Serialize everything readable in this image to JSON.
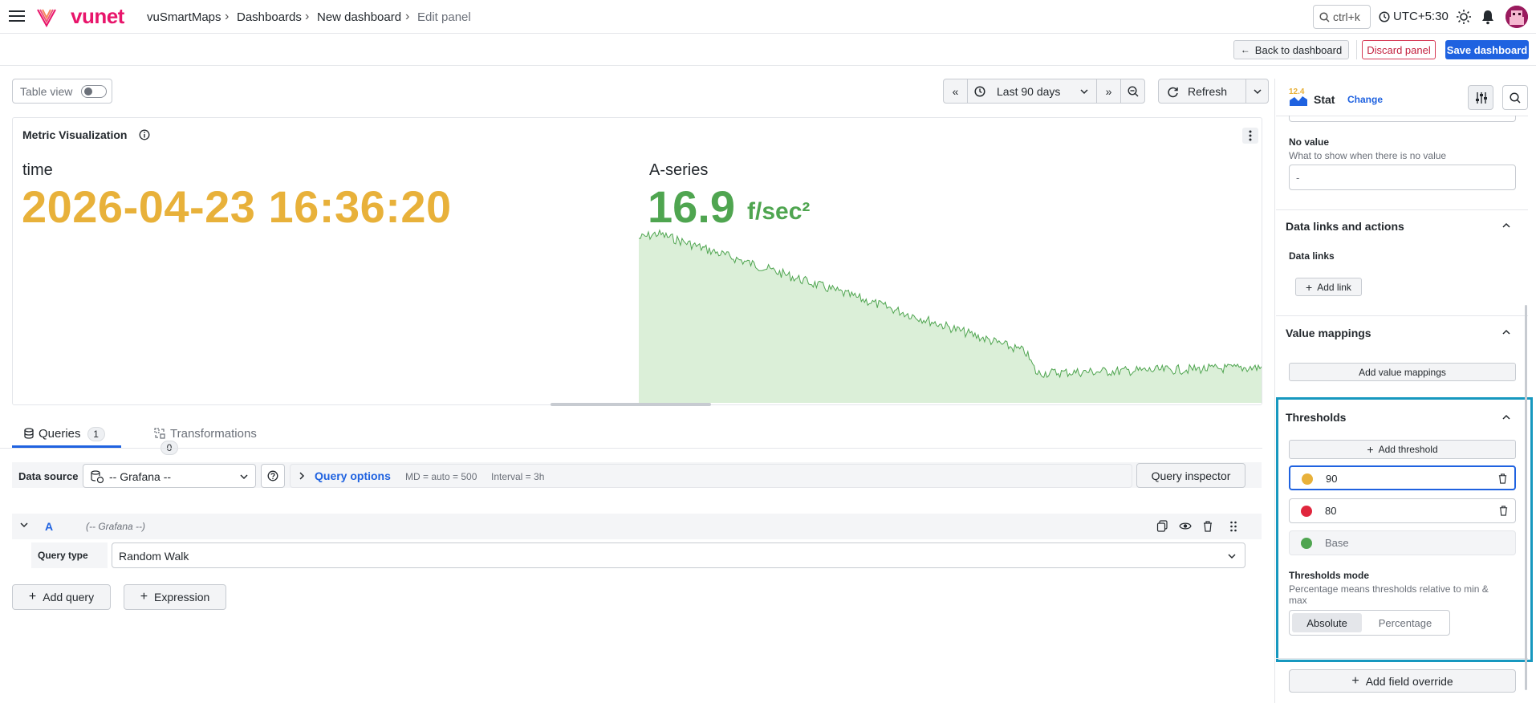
{
  "header": {
    "logo_text": "vunet",
    "breadcrumbs": [
      "vuSmartMaps",
      "Dashboards",
      "New dashboard",
      "Edit panel"
    ],
    "search_shortcut": "ctrl+k",
    "timezone": "UTC+5:30"
  },
  "toolbar": {
    "back_label": "Back to dashboard",
    "discard_label": "Discard panel",
    "save_label": "Save dashboard"
  },
  "panel_controls": {
    "table_view_label": "Table view",
    "table_view_on": false,
    "time_range": "Last 90 days",
    "refresh_label": "Refresh"
  },
  "panel": {
    "title": "Metric Visualization",
    "stats": [
      {
        "label": "time",
        "value": "2026-04-23 16:36:20",
        "color": "#e8b13a"
      },
      {
        "label": "A-series",
        "value": "16.9",
        "unit": "f/sec²",
        "color": "#4fa550"
      }
    ]
  },
  "query_tabs": [
    {
      "label": "Queries",
      "count": "1"
    },
    {
      "label": "Transformations",
      "count": "0"
    }
  ],
  "query_editor": {
    "data_source_label": "Data source",
    "data_source_value": "-- Grafana --",
    "query_options_label": "Query options",
    "md_text": "MD = auto = 500",
    "interval_text": "Interval = 3h",
    "inspector_label": "Query inspector",
    "query_letter": "A",
    "query_ds": "(-- Grafana --)",
    "query_type_label": "Query type",
    "query_type_value": "Random Walk",
    "add_query_label": "Add query",
    "expression_label": "Expression"
  },
  "sidebar": {
    "viz_icon_text": "12.4",
    "viz_type": "Stat",
    "change_label": "Change",
    "no_value_title": "No value",
    "no_value_desc": "What to show when there is no value",
    "no_value_input": "-",
    "data_links_title": "Data links and actions",
    "data_links_sub": "Data links",
    "add_link_label": "Add link",
    "value_mappings_title": "Value mappings",
    "add_mappings_label": "Add value mappings",
    "thresholds_title": "Thresholds",
    "add_threshold_label": "Add threshold",
    "thresholds": [
      {
        "value": "90",
        "color": "#e8b13a"
      },
      {
        "value": "80",
        "color": "#e0263d"
      },
      {
        "value": "Base",
        "color": "#4fa550"
      }
    ],
    "thresholds_mode_title": "Thresholds mode",
    "thresholds_mode_desc": "Percentage means thresholds relative to min & max",
    "mode_absolute": "Absolute",
    "mode_percentage": "Percentage",
    "add_override_label": "Add field override"
  }
}
